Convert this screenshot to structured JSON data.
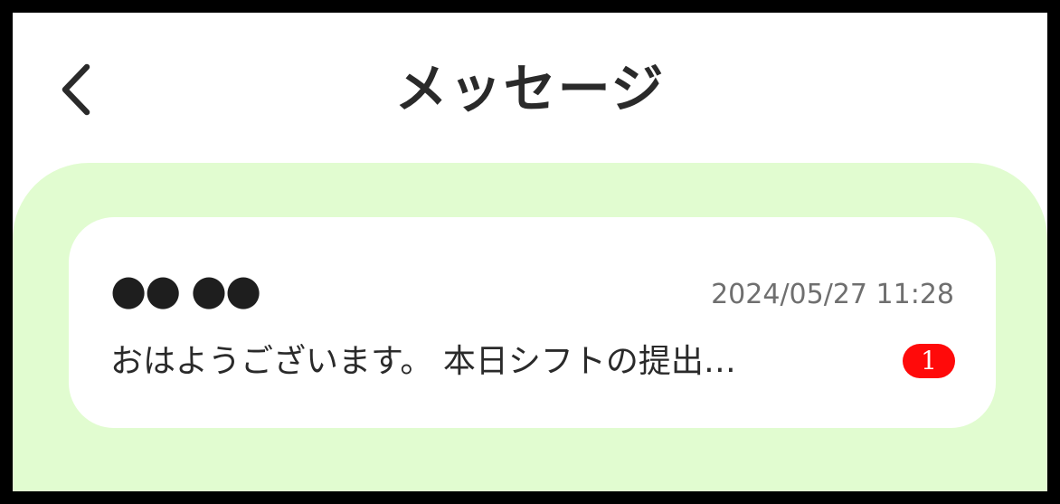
{
  "header": {
    "title": "メッセージ",
    "back_icon": "chevron-left-icon"
  },
  "messages": [
    {
      "sender": "●● ●●",
      "timestamp": "2024/05/27 11:28",
      "preview": "おはようございます。 本日シフトの提出…",
      "unread_count": "1"
    }
  ],
  "colors": {
    "content_background": "#e1fcd0",
    "card_background": "#ffffff",
    "badge": "#ff0a0a",
    "title_text": "#2a2a2a",
    "timestamp_text": "#6f6f6f"
  }
}
